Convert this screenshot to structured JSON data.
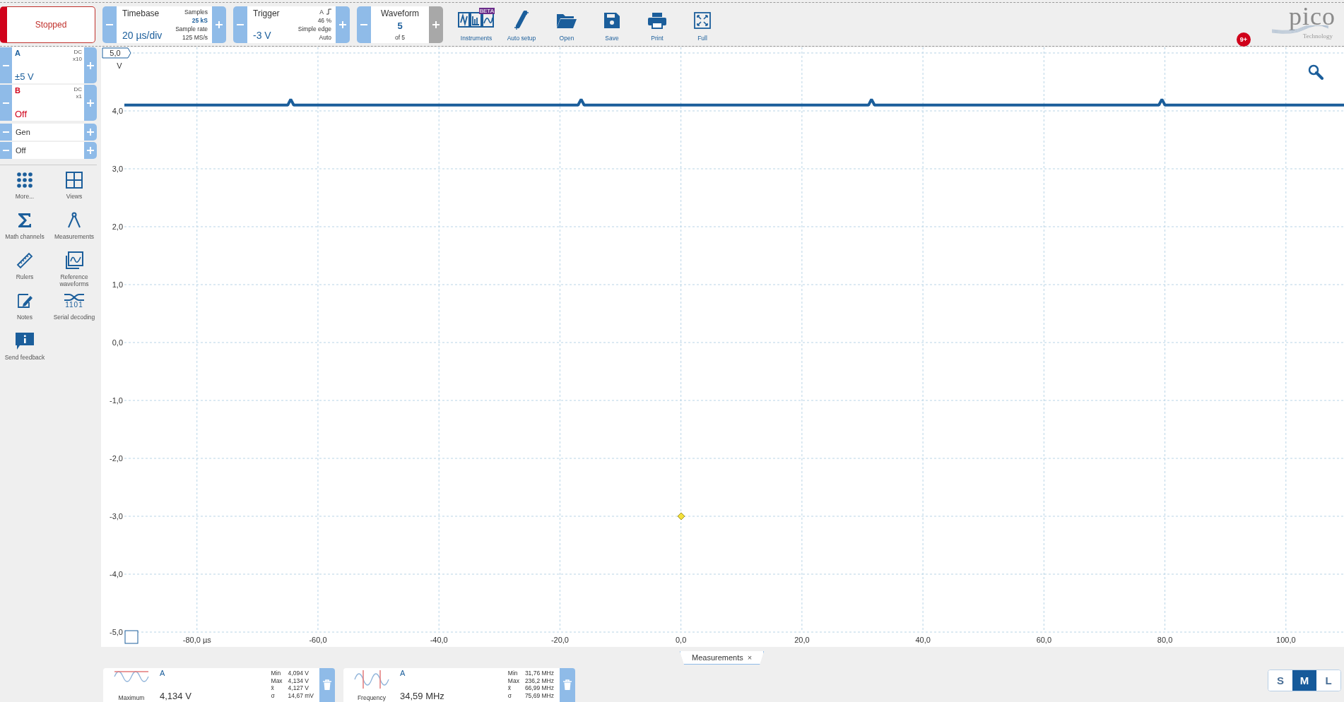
{
  "run_button": {
    "label": "Stopped"
  },
  "timebase": {
    "title": "Timebase",
    "value": "20 µs/div",
    "samples_label": "Samples",
    "samples": "25 kS",
    "rate_label": "Sample rate",
    "rate": "125 MS/s"
  },
  "trigger": {
    "title": "Trigger",
    "value": "-3 V",
    "channel": "A",
    "percent": "46 %",
    "type": "Simple edge",
    "mode": "Auto"
  },
  "waveform": {
    "title": "Waveform",
    "value": "5",
    "of": "of 5",
    "next_disabled": true
  },
  "toolbar": [
    {
      "kind": "instruments",
      "label": "Instruments",
      "badge": "BETA"
    },
    {
      "kind": "autosetup",
      "label": "Auto setup"
    },
    {
      "kind": "open",
      "label": "Open"
    },
    {
      "kind": "save",
      "label": "Save"
    },
    {
      "kind": "print",
      "label": "Print"
    },
    {
      "kind": "full",
      "label": "Full"
    }
  ],
  "notifications": "9+",
  "logo": {
    "name": "pico",
    "tagline": "Technology"
  },
  "channels": [
    {
      "name": "A",
      "coupling": "DC",
      "probe": "x10",
      "range": "±5 V",
      "color": "#1b5e9b"
    },
    {
      "name": "B",
      "coupling": "DC",
      "probe": "x1",
      "range": "Off",
      "color": "#d0021b"
    }
  ],
  "generator": {
    "name": "Gen",
    "state": "Off"
  },
  "tools": [
    {
      "kind": "more",
      "label": "More..."
    },
    {
      "kind": "views",
      "label": "Views"
    },
    {
      "kind": "math",
      "label": "Math channels"
    },
    {
      "kind": "measure",
      "label": "Measurements"
    },
    {
      "kind": "rulers",
      "label": "Rulers"
    },
    {
      "kind": "reference",
      "label": "Reference waveforms"
    },
    {
      "kind": "notes",
      "label": "Notes"
    },
    {
      "kind": "serial",
      "label": "Serial decoding"
    },
    {
      "kind": "feedback",
      "label": "Send feedback"
    }
  ],
  "serial_icon_digits": "1101",
  "scope": {
    "chart_data": {
      "type": "line",
      "ylabel": "V",
      "grid": true,
      "xlim": [
        -92,
        109.6
      ],
      "ylim": [
        -5,
        5
      ],
      "xticks": [
        {
          "value": -80,
          "label": "-80,0 µs"
        },
        {
          "value": -60,
          "label": "-60,0"
        },
        {
          "value": -40,
          "label": "-40,0"
        },
        {
          "value": -20,
          "label": "-20,0"
        },
        {
          "value": 0,
          "label": "0,0"
        },
        {
          "value": 20,
          "label": "20,0"
        },
        {
          "value": 40,
          "label": "40,0"
        },
        {
          "value": 60,
          "label": "60,0"
        },
        {
          "value": 80,
          "label": "80,0"
        },
        {
          "value": 100,
          "label": "100,0"
        }
      ],
      "yticks": [
        {
          "value": 5,
          "label": "5,0"
        },
        {
          "value": 4,
          "label": "4,0"
        },
        {
          "value": 3,
          "label": "3,0"
        },
        {
          "value": 2,
          "label": "2,0"
        },
        {
          "value": 1,
          "label": "1,0"
        },
        {
          "value": 0,
          "label": "0,0"
        },
        {
          "value": -1,
          "label": "-1,0"
        },
        {
          "value": -2,
          "label": "-2,0"
        },
        {
          "value": -3,
          "label": "-3,0"
        },
        {
          "value": -4,
          "label": "-4,0"
        },
        {
          "value": -5,
          "label": "-5,0"
        }
      ],
      "x": [
        -92,
        -65,
        -64.5,
        -64,
        -17,
        -16.5,
        -16,
        31,
        31.5,
        32,
        79,
        79.5,
        80,
        109.6
      ],
      "series": [
        {
          "color": "#1b5e9b",
          "values": [
            4.1,
            4.1,
            4.2,
            4.1,
            4.1,
            4.2,
            4.1,
            4.1,
            4.2,
            4.1,
            4.1,
            4.2,
            4.1,
            4.1
          ]
        }
      ]
    }
  },
  "measurements_tab": {
    "label": "Measurements",
    "close": "×"
  },
  "measurements": [
    {
      "kind": "maximum",
      "name": "Maximum",
      "channel": "A",
      "value": "4,134 V",
      "stats": [
        {
          "label": "Min",
          "value": "4,094 V"
        },
        {
          "label": "Max",
          "value": "4,134 V"
        },
        {
          "label": "x̄",
          "value": "4,127 V"
        },
        {
          "label": "σ",
          "value": "14,67 mV"
        }
      ]
    },
    {
      "kind": "frequency",
      "name": "Frequency",
      "channel": "A",
      "value": "34,59 MHz",
      "stats": [
        {
          "label": "Min",
          "value": "31,76 MHz"
        },
        {
          "label": "Max",
          "value": "236,2 MHz"
        },
        {
          "label": "x̄",
          "value": "66,99 MHz"
        },
        {
          "label": "σ",
          "value": "75,69 MHz"
        }
      ]
    }
  ],
  "size_buttons": [
    {
      "label": "S",
      "selected": false
    },
    {
      "label": "M",
      "selected": true
    },
    {
      "label": "L",
      "selected": false
    }
  ]
}
